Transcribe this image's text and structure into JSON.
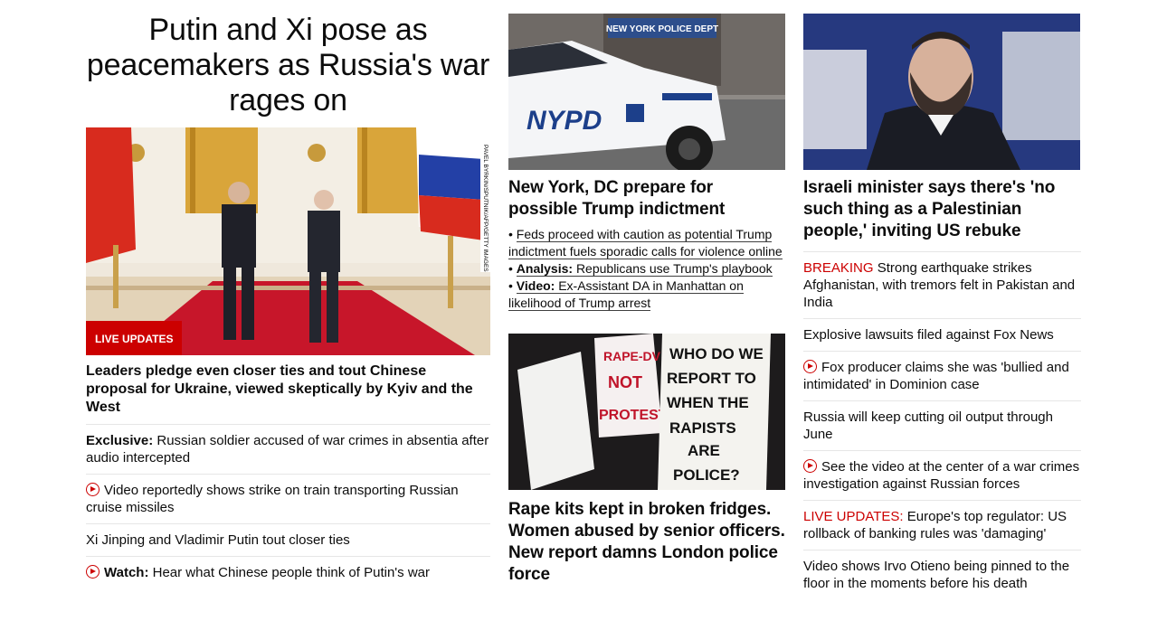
{
  "lead_story": {
    "title": "Putin and Xi pose as peacemakers as Russia's war rages on",
    "badge": "LIVE UPDATES",
    "photo_credit": "PAVEL BYRKIN/SPUTNIK/AFP/GETTY IMAGES",
    "headline": "Leaders pledge even closer ties and tout Chinese proposal for Ukraine, viewed skeptically by Kyiv and the West",
    "related": [
      {
        "prefix": "Exclusive:",
        "text": " Russian soldier accused of war crimes in absentia after audio intercepted",
        "video": false
      },
      {
        "prefix": "",
        "text": "Video reportedly shows strike on train transporting Russian cruise missiles",
        "video": true
      },
      {
        "prefix": "",
        "text": "Xi Jinping and Vladimir Putin tout closer ties",
        "video": false
      },
      {
        "prefix": "Watch:",
        "text": " Hear what Chinese people think of Putin's war",
        "video": true
      }
    ]
  },
  "story_nypd": {
    "title": "New York, DC prepare for possible Trump indictment",
    "image_alt": "NYPD police car",
    "links": [
      {
        "prefix": "",
        "text": "Feds proceed with caution as potential Trump indictment fuels sporadic calls for violence online"
      },
      {
        "prefix": "Analysis:",
        "text": "Republicans use Trump's playbook"
      },
      {
        "prefix": "Video:",
        "text": "Ex-Assistant DA in Manhattan on likelihood of Trump arrest"
      }
    ]
  },
  "story_police": {
    "title": "Rape kits kept in broken fridges. Women abused by senior officers. New report damns London police force",
    "sign_left": "RAPE-DV NOT PROTEST",
    "sign_right": "WHO DO WE REPORT TO WHEN THE RAPISTS ARE POLICE?"
  },
  "story_israel": {
    "title": "Israeli minister says there's 'no such thing as a Palestinian people,' inviting US rebuke",
    "list": [
      {
        "label": "BREAKING",
        "text": " Strong earthquake strikes Afghanistan, with tremors felt in Pakistan and India",
        "video": false
      },
      {
        "label": "",
        "text": "Explosive lawsuits filed against Fox News",
        "video": false
      },
      {
        "label": "",
        "text": "Fox producer claims she was 'bullied and intimidated' in Dominion case",
        "video": true
      },
      {
        "label": "",
        "text": "Russia will keep cutting oil output through June",
        "video": false
      },
      {
        "label": "",
        "text": "See the video at the center of a war crimes investigation against Russian forces",
        "video": true
      },
      {
        "label": "LIVE UPDATES:",
        "text": " Europe's top regulator: US rollback of banking rules was 'damaging'",
        "video": false
      },
      {
        "label": "",
        "text": "Video shows Irvo Otieno being pinned to the floor in the moments before his death",
        "video": false
      }
    ]
  },
  "colors": {
    "accent": "#cc0000",
    "text": "#0c0c0c",
    "divider": "#e6e6e6"
  }
}
